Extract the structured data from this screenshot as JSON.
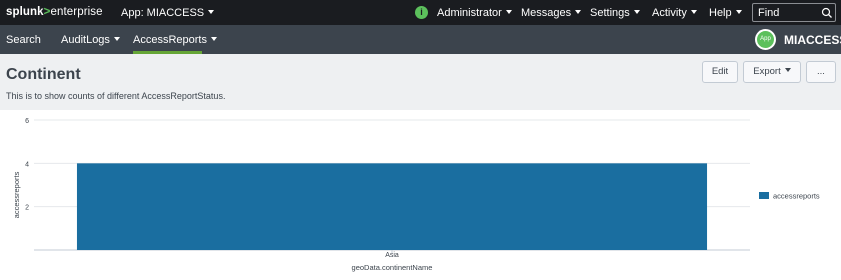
{
  "topbar": {
    "logo_splunk": "splunk",
    "logo_gt": ">",
    "logo_enterprise": "enterprise",
    "app_menu": "App: MIACCESS",
    "info_icon": "i",
    "administrator": "Administrator",
    "messages": "Messages",
    "settings": "Settings",
    "activity": "Activity",
    "help": "Help",
    "find_placeholder": "Find"
  },
  "appbar": {
    "search": "Search",
    "auditlogs": "AuditLogs",
    "accessreports": "AccessReports",
    "app_badge": "App",
    "app_name": "MIACCESS"
  },
  "header": {
    "title": "Continent",
    "description": "This is to show counts of different AccessReportStatus.",
    "edit_label": "Edit",
    "export_label": "Export",
    "more_label": "..."
  },
  "colors": {
    "bar": "#1a6ea0",
    "accent_green": "#65a637"
  },
  "chart_data": {
    "type": "bar",
    "categories": [
      "Asia"
    ],
    "series": [
      {
        "name": "accessreports",
        "values": [
          4
        ]
      }
    ],
    "xlabel": "geoData.continentName",
    "ylabel": "accessreports",
    "ylim": [
      0,
      6
    ],
    "yticks": [
      2,
      4,
      6
    ],
    "grid": true,
    "legend": "right"
  }
}
